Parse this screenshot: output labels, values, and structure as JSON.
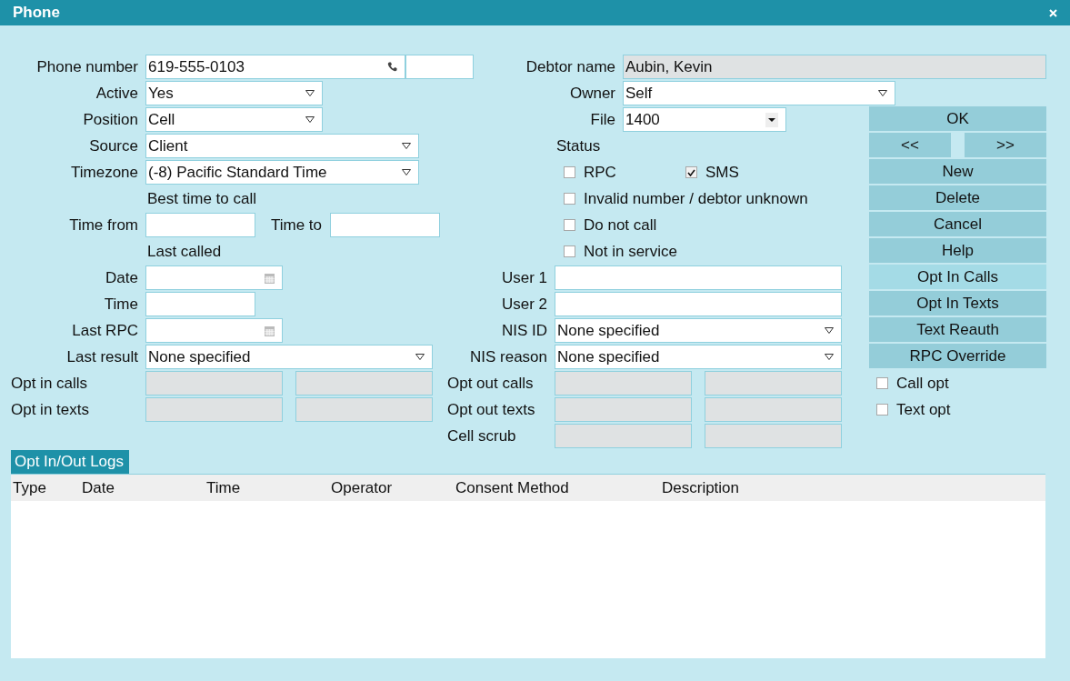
{
  "window": {
    "title": "Phone"
  },
  "left_rows": [
    {
      "kind": "field",
      "label": "Phone number",
      "controls": [
        {
          "kind": "phone",
          "value": "619-555-0103"
        },
        {
          "kind": "text"
        }
      ]
    },
    {
      "kind": "field",
      "label": "Active",
      "controls": [
        {
          "kind": "select",
          "value": "Yes"
        }
      ]
    },
    {
      "kind": "field",
      "label": "Position",
      "controls": [
        {
          "kind": "select",
          "value": "Cell"
        }
      ]
    },
    {
      "kind": "field",
      "label": "Source",
      "controls": [
        {
          "kind": "select",
          "value": "Client"
        }
      ]
    },
    {
      "kind": "field",
      "label": "Timezone",
      "controls": [
        {
          "kind": "select",
          "value": "(-8) Pacific Standard Time"
        }
      ]
    },
    {
      "kind": "heading",
      "text": "Best time to call"
    },
    {
      "kind": "field",
      "label": "Time from",
      "controls": [
        {
          "kind": "text"
        },
        {
          "kind": "label",
          "text": "Time to"
        },
        {
          "kind": "text"
        }
      ]
    },
    {
      "kind": "heading",
      "text": "Last called"
    },
    {
      "kind": "field",
      "label": "Date",
      "controls": [
        {
          "kind": "date"
        }
      ]
    },
    {
      "kind": "field",
      "label": "Time",
      "controls": [
        {
          "kind": "text"
        }
      ]
    },
    {
      "kind": "field",
      "label": "Last RPC",
      "controls": [
        {
          "kind": "date"
        }
      ]
    },
    {
      "kind": "field",
      "label": "Last result",
      "controls": [
        {
          "kind": "select",
          "value": "None specified"
        }
      ]
    },
    {
      "kind": "field-left",
      "label": "Opt in calls",
      "controls": [
        {
          "kind": "readonly"
        },
        {
          "kind": "readonly"
        }
      ]
    },
    {
      "kind": "field-left",
      "label": "Opt in texts",
      "controls": [
        {
          "kind": "readonly"
        },
        {
          "kind": "readonly"
        }
      ]
    }
  ],
  "top_rows": [
    {
      "kind": "field",
      "label": "Debtor name",
      "controls": [
        {
          "kind": "readonly",
          "value": "Aubin, Kevin"
        }
      ]
    },
    {
      "kind": "field",
      "label": "Owner",
      "controls": [
        {
          "kind": "select",
          "value": "Self"
        }
      ]
    }
  ],
  "middle_rows": [
    {
      "kind": "field",
      "label": "File",
      "controls": [
        {
          "kind": "combo",
          "value": "1400"
        }
      ]
    },
    {
      "kind": "heading",
      "text": "Status"
    },
    {
      "kind": "checks",
      "items": [
        {
          "label": "RPC",
          "checked": false
        },
        {
          "label": "SMS",
          "checked": true
        }
      ]
    },
    {
      "kind": "checks",
      "items": [
        {
          "label": "Invalid number / debtor unknown",
          "checked": false
        }
      ]
    },
    {
      "kind": "checks",
      "items": [
        {
          "label": "Do not call",
          "checked": false
        }
      ]
    },
    {
      "kind": "checks",
      "items": [
        {
          "label": "Not in service",
          "checked": false
        }
      ]
    },
    {
      "kind": "field",
      "label": "User 1",
      "controls": [
        {
          "kind": "text"
        }
      ]
    },
    {
      "kind": "field",
      "label": "User 2",
      "controls": [
        {
          "kind": "text"
        }
      ]
    },
    {
      "kind": "field",
      "label": "NIS ID",
      "controls": [
        {
          "kind": "select",
          "value": "None specified"
        }
      ]
    },
    {
      "kind": "field",
      "label": "NIS reason",
      "controls": [
        {
          "kind": "select",
          "value": "None specified"
        }
      ]
    },
    {
      "kind": "field-left",
      "label": "Opt out calls",
      "controls": [
        {
          "kind": "readonly"
        },
        {
          "kind": "readonly"
        }
      ]
    },
    {
      "kind": "field-left",
      "label": "Opt out texts",
      "controls": [
        {
          "kind": "readonly"
        },
        {
          "kind": "readonly"
        }
      ]
    },
    {
      "kind": "field-left",
      "label": "Cell scrub",
      "controls": [
        {
          "kind": "readonly"
        },
        {
          "kind": "readonly"
        }
      ]
    }
  ],
  "buttons": [
    {
      "kind": "button",
      "label": "OK",
      "hovered": false
    },
    {
      "kind": "pair",
      "items": [
        {
          "label": "<<",
          "hovered": false
        },
        {
          "label": ">>",
          "hovered": false
        }
      ]
    },
    {
      "kind": "button",
      "label": "New",
      "hovered": false
    },
    {
      "kind": "button",
      "label": "Delete",
      "hovered": false
    },
    {
      "kind": "button",
      "label": "Cancel",
      "hovered": false
    },
    {
      "kind": "button",
      "label": "Help",
      "hovered": false
    },
    {
      "kind": "button",
      "label": "Opt In Calls",
      "hovered": true
    },
    {
      "kind": "button",
      "label": "Opt In Texts",
      "hovered": false
    },
    {
      "kind": "button",
      "label": "Text Reauth",
      "hovered": false
    },
    {
      "kind": "button",
      "label": "RPC Override",
      "hovered": false
    },
    {
      "kind": "check",
      "label": "Call opt",
      "checked": false
    },
    {
      "kind": "check",
      "label": "Text opt",
      "checked": false
    }
  ],
  "logs": {
    "tab": "Opt In/Out Logs",
    "columns": [
      "Type",
      "Date",
      "Time",
      "Operator",
      "Consent Method",
      "Description"
    ]
  }
}
